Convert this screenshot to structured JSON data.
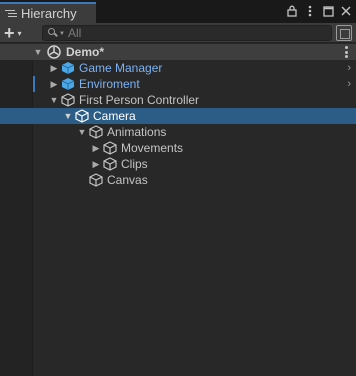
{
  "panel": {
    "tab_label": "Hierarchy",
    "lock_glyph": "🔒",
    "menu_glyph": "⋮",
    "maximize_glyph": "□",
    "close_glyph": "✕"
  },
  "toolbar": {
    "add_label": "+",
    "add_caret": "▾",
    "search_placeholder": "All"
  },
  "colors": {
    "accent": "#3a79bb",
    "selection": "#2c5d87",
    "prefab_text": "#7bb2f2",
    "prefab_mark": "#3a79bb"
  },
  "tree": {
    "scene": {
      "label": "Demo*",
      "expanded": true,
      "icon": "unity-scene-icon"
    },
    "items": [
      {
        "label": "Game Manager",
        "depth": 1,
        "prefab": true,
        "foldout": "closed",
        "icon": "prefab-cube-icon",
        "selected": false
      },
      {
        "label": "Enviroment",
        "depth": 1,
        "prefab": true,
        "foldout": "closed",
        "icon": "prefab-cube-icon",
        "selected": false
      },
      {
        "label": "First Person Controller",
        "depth": 1,
        "prefab": false,
        "foldout": "open",
        "icon": "gameobject-cube-icon",
        "selected": false
      },
      {
        "label": "Camera",
        "depth": 2,
        "prefab": false,
        "foldout": "open",
        "icon": "gameobject-cube-icon",
        "selected": true
      },
      {
        "label": "Animations",
        "depth": 3,
        "prefab": false,
        "foldout": "open",
        "icon": "gameobject-cube-icon",
        "selected": false
      },
      {
        "label": "Movements",
        "depth": 4,
        "prefab": false,
        "foldout": "closed",
        "icon": "gameobject-cube-icon",
        "selected": false
      },
      {
        "label": "Clips",
        "depth": 4,
        "prefab": false,
        "foldout": "closed",
        "icon": "gameobject-cube-icon",
        "selected": false
      },
      {
        "label": "Canvas",
        "depth": 3,
        "prefab": false,
        "foldout": "none",
        "icon": "gameobject-cube-icon",
        "selected": false
      }
    ]
  }
}
